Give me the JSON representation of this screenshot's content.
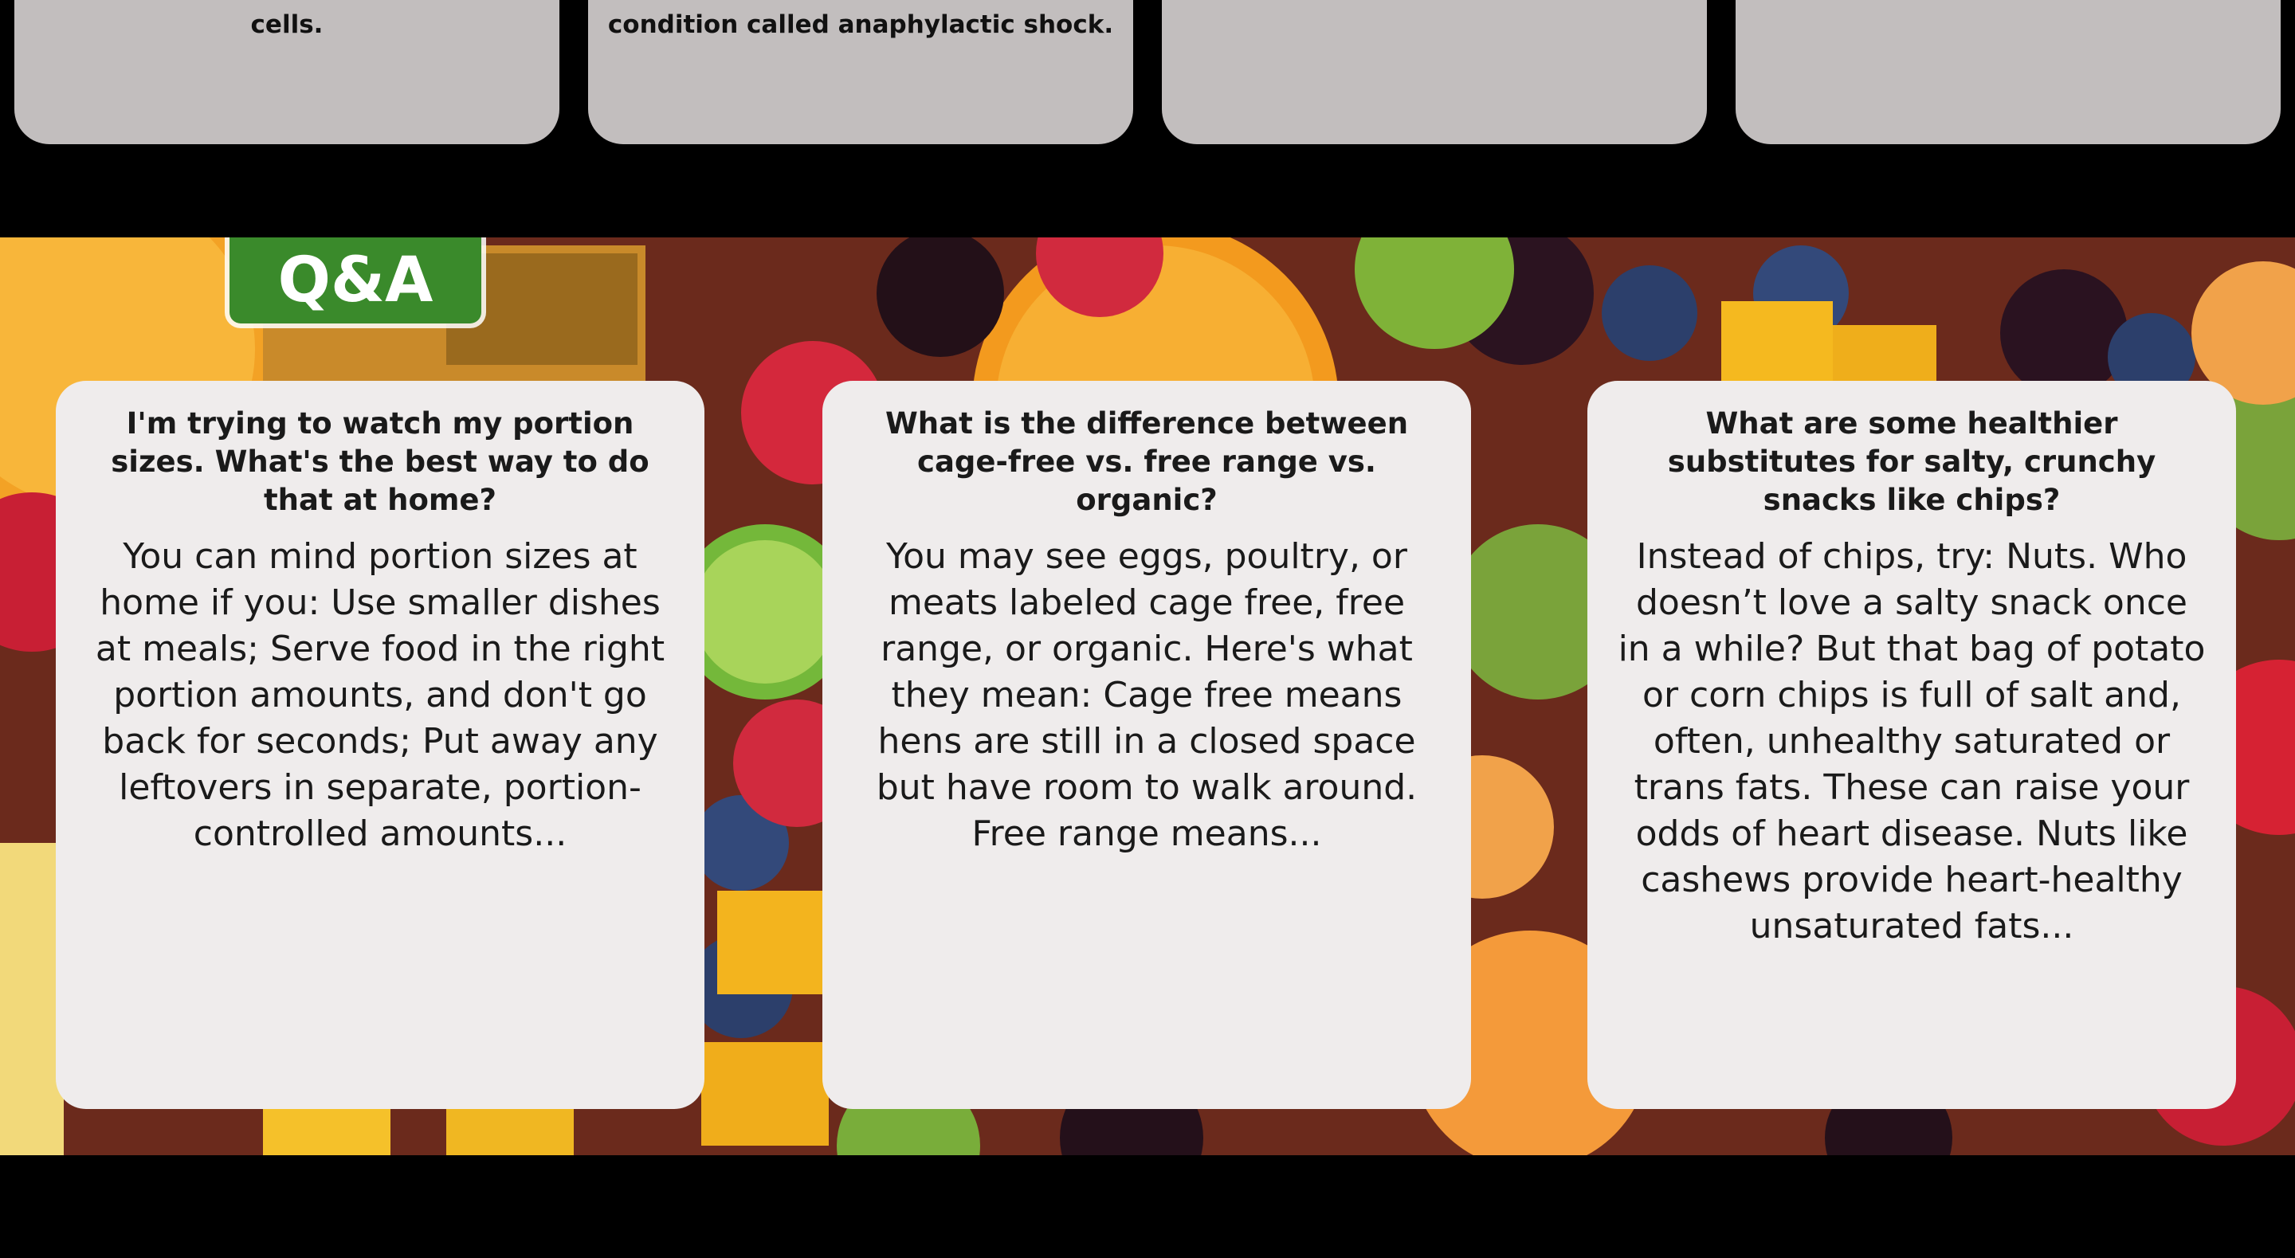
{
  "top_cards": [
    {
      "text": "cells."
    },
    {
      "text": "condition called anaphylactic shock."
    },
    {
      "text": ""
    },
    {
      "text": ""
    }
  ],
  "qa": {
    "badge": "Q&A",
    "cards": [
      {
        "question": "I'm trying to watch my portion sizes. What's the best way to do that at home?",
        "answer": "You can mind portion sizes at home if you: Use smaller dishes at meals; Serve food in the right portion amounts, and don't go back for seconds; Put away any leftovers in separate, portion-controlled amounts..."
      },
      {
        "question": "What is the difference between cage-free vs. free range vs. organic?",
        "answer": "You may see eggs, poultry, or meats labeled cage free, free range, or organic. Here's what they mean: Cage free means hens are still in a closed space but have room to walk around. Free range means..."
      },
      {
        "question": "What are some healthier substitutes for salty, crunchy snacks like chips?",
        "answer": "Instead of chips, try: Nuts. Who doesn’t love a salty snack once in a while? But that bag of potato or corn chips is full of salt and, often, unhealthy saturated or trans fats. These can raise your odds of heart disease. Nuts like cashews provide heart-healthy unsaturated fats..."
      }
    ]
  },
  "colors": {
    "badge_green": "#3a8a2b",
    "card_bg": "#efecec",
    "top_card_bg": "#c2bebe"
  }
}
